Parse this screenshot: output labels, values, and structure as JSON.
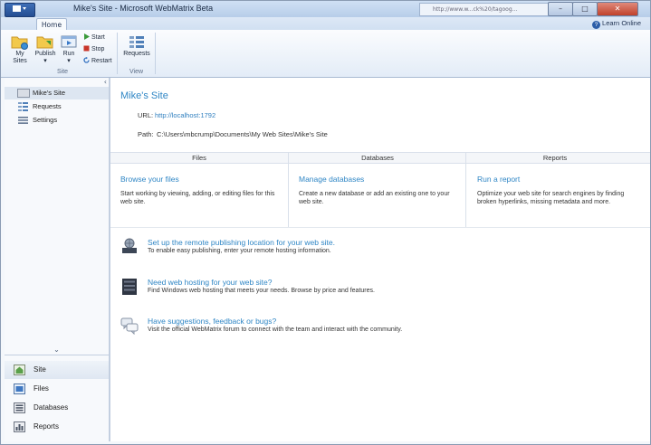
{
  "window": {
    "title": "Mike's Site - Microsoft WebMatrix Beta",
    "address_hint": "http://www.w...ck%20/tagoog...",
    "min_glyph": "–",
    "max_glyph": "□",
    "close_glyph": "✕"
  },
  "ribbon": {
    "tab_home": "Home",
    "help_glyph": "?",
    "help_label": "Learn Online",
    "my_sites_l1": "My",
    "my_sites_l2": "Sites",
    "publish_label": "Publish",
    "run_label": "Run",
    "dropdown_glyph": "▾",
    "start_label": "Start",
    "stop_label": "Stop",
    "restart_label": "Restart",
    "group_site": "Site",
    "requests_label": "Requests",
    "group_view": "View"
  },
  "nav": {
    "collapse_glyph": "‹",
    "expand_glyph": "⌄",
    "tree": [
      "Mike's Site",
      "Requests",
      "Settings"
    ],
    "workspaces": [
      "Site",
      "Files",
      "Databases",
      "Reports"
    ]
  },
  "main": {
    "site_title": "Mike's Site",
    "url_label": "URL:",
    "url_value": "http://localhost:1792",
    "path_label": "Path:",
    "path_value": "C:\\Users\\mbcrump\\Documents\\My Web Sites\\Mike's Site",
    "columns": [
      "Files",
      "Databases",
      "Reports"
    ],
    "cards": [
      {
        "title": "Browse your files",
        "desc": "Start working by viewing, adding, or editing files for this web site."
      },
      {
        "title": "Manage databases",
        "desc": "Create a new database or add an existing one to your web site."
      },
      {
        "title": "Run a report",
        "desc": "Optimize your web site for search engines by finding broken hyperlinks, missing metadata and more."
      }
    ],
    "tips": [
      {
        "title": "Set up the remote publishing location for your web site.",
        "desc": "To enable easy publishing, enter your remote hosting information.",
        "icon": "server-globe-icon"
      },
      {
        "title": "Need web hosting for your web site?",
        "desc": "Find Windows web hosting that meets your needs. Browse by price and features.",
        "icon": "server-rack-icon"
      },
      {
        "title": "Have suggestions, feedback or bugs?",
        "desc": "Visit the official WebMatrix forum to connect with the team and interact with the community.",
        "icon": "speech-bubbles-icon"
      }
    ]
  },
  "colors": {
    "link_blue": "#2f86c5",
    "ribbon_bg": "#e3ecf7",
    "close_red": "#c0412b"
  }
}
